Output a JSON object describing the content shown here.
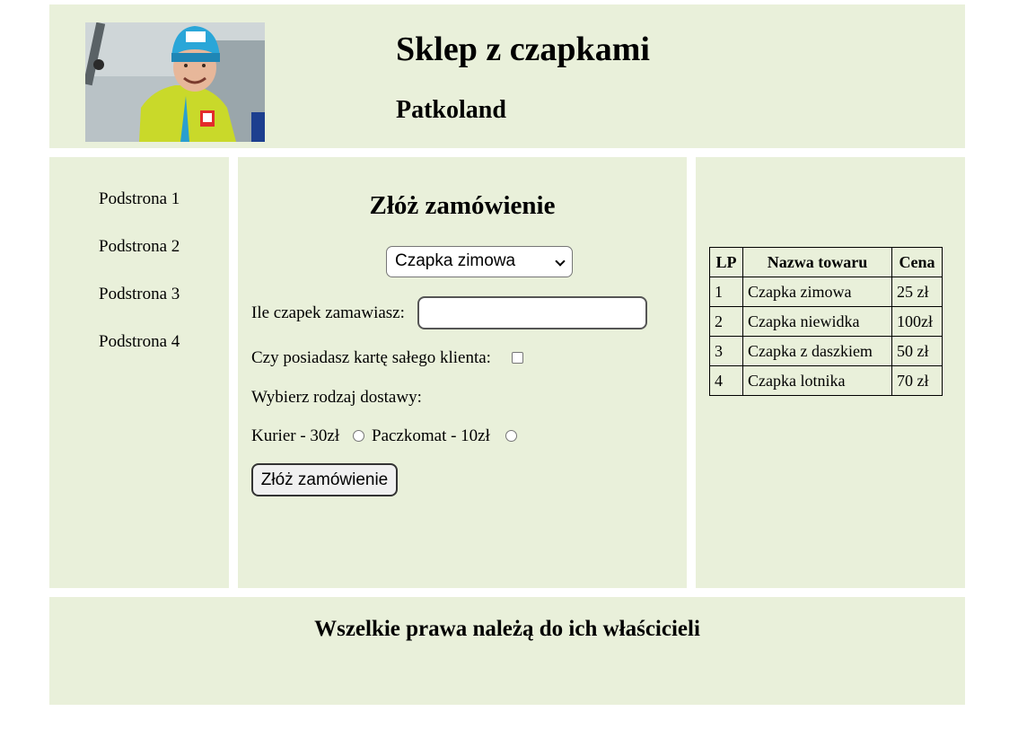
{
  "header": {
    "title": "Sklep z czapkami",
    "subtitle": "Patkoland",
    "photo_icon": "person-photo"
  },
  "nav": {
    "items": [
      {
        "label": "Podstrona 1"
      },
      {
        "label": "Podstrona 2"
      },
      {
        "label": "Podstrona 3"
      },
      {
        "label": "Podstrona 4"
      }
    ]
  },
  "form": {
    "title": "Złóż zamówienie",
    "select_value": "Czapka zimowa",
    "quantity_label": "Ile czapek zamawiasz:",
    "quantity_value": "",
    "card_label": "Czy posiadasz kartę sałego klienta:",
    "card_checked": false,
    "delivery_label": "Wybierz rodzaj dostawy:",
    "delivery_option_1": "Kurier - 30zł",
    "delivery_option_2": "Paczkomat - 10zł",
    "submit_label": "Złóż zamówienie"
  },
  "table": {
    "headers": [
      "LP",
      "Nazwa towaru",
      "Cena"
    ],
    "rows": [
      [
        "1",
        "Czapka zimowa",
        "25 zł"
      ],
      [
        "2",
        "Czapka niewidka",
        "100zł"
      ],
      [
        "3",
        "Czapka z daszkiem",
        "50 zł"
      ],
      [
        "4",
        "Czapka lotnika",
        "70 zł"
      ]
    ]
  },
  "footer": {
    "text": "Wszelkie prawa należą do ich właścicieli"
  },
  "colors": {
    "panel_bg": "#e9f0da",
    "page_bg": "#ffffff"
  }
}
